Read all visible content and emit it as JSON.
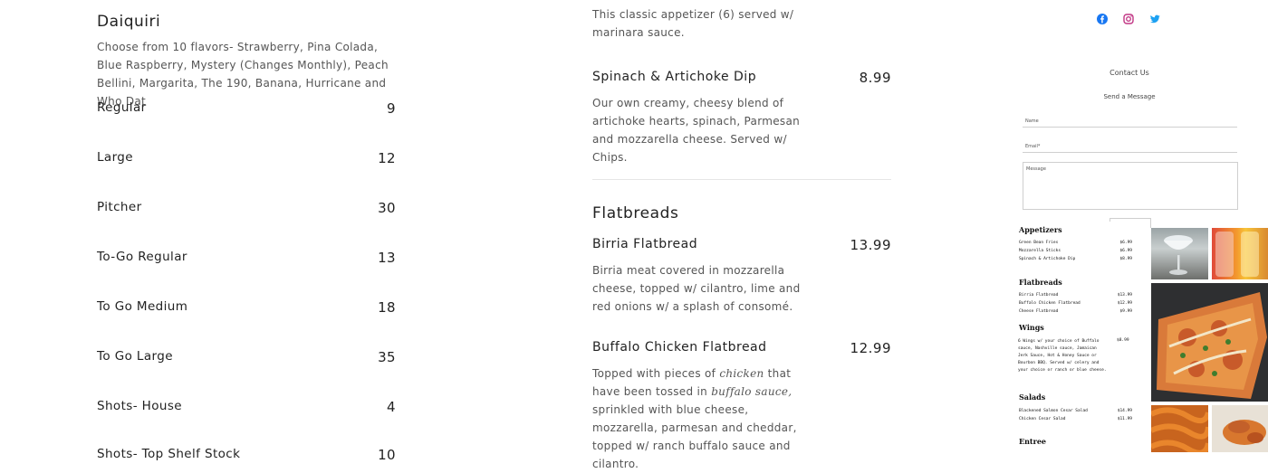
{
  "drinks": {
    "title": "Daiquiri",
    "description": "Choose from 10 flavors- Strawberry, Pina Colada, Blue Raspberry, Mystery (Changes Monthly), Peach Bellini, Margarita, The 190, Banana, Hurricane and Who Dat",
    "prices": [
      {
        "label": "Regular",
        "price": "9"
      },
      {
        "label": "Large",
        "price": "12"
      },
      {
        "label": "Pitcher",
        "price": "30"
      },
      {
        "label": "To-Go Regular",
        "price": "13"
      },
      {
        "label": "To Go Medium",
        "price": "18"
      },
      {
        "label": "To Go Large",
        "price": "35"
      },
      {
        "label": "Shots- House",
        "price": "4"
      },
      {
        "label": "Shots- Top Shelf Stock",
        "price": "10"
      }
    ]
  },
  "menu": {
    "top_fragment": " This classic appetizer (6)  served w/ marinara sauce.",
    "spinach": {
      "name": "Spinach & Artichoke Dip",
      "price": "8.99",
      "description": "Our own creamy, cheesy blend of artichoke hearts, spinach, Parmesan and mozzarella cheese. Served w/ Chips."
    },
    "flatbreads_heading": "Flatbreads",
    "birria": {
      "name": "Birria Flatbread",
      "price": "13.99",
      "description": "Birria meat covered in mozzarella cheese, topped w/  cilantro, lime and red onions w/ a splash of consomé."
    },
    "buffalo": {
      "name": "Buffalo Chicken Flatbread",
      "price": "12.99",
      "desc_a": " Topped with pieces of ",
      "desc_em1": "chicken",
      "desc_b": " that have been tossed in ",
      "desc_em2": "buffalo sauce,",
      "desc_c": " sprinkled with blue cheese, mozzarella, parmesan and cheddar, topped w/ ranch buffalo sauce and cilantro."
    }
  },
  "social": {
    "icons": [
      "facebook-icon",
      "instagram-icon",
      "twitter-icon"
    ],
    "color": "#1877f2"
  },
  "contact": {
    "title": "Contact Us",
    "send_title": "Send a Message",
    "name_label": "Name",
    "email_label": "Email*",
    "message_label": "Message"
  },
  "menu_image": {
    "appetizers": "Appetizers",
    "app_items": [
      {
        "name": "Green Bean Fries",
        "price": "$6.99"
      },
      {
        "name": "Mozzarella Sticks",
        "price": "$6.99"
      },
      {
        "name": "Spinach & Artichoke Dip",
        "price": "$8.99"
      }
    ],
    "flatbreads": "Flatbreads",
    "flat_items": [
      {
        "name": "Birria Flatbread",
        "price": "$13.99"
      },
      {
        "name": "Buffalo Chicken Flatbread",
        "price": "$12.99"
      },
      {
        "name": "Cheese Flatbread",
        "price": "$9.99"
      }
    ],
    "wings": "Wings",
    "wings_desc": "6 Wings w/ your choice of Buffalo sauce, Nashville sauce, Jamaican Jerk Sauce, Hot & Honey Sauce or Bourbon BBQ. Served w/ celery and your choice or ranch or blue cheese.",
    "wings_price": "$8.99",
    "salads": "Salads",
    "salad_items": [
      {
        "name": "Blackened Salmon Cesar Salad",
        "price": "$14.99"
      },
      {
        "name": "Chicken Cesar Salad",
        "price": "$11.99"
      }
    ],
    "entree": "Entree"
  }
}
